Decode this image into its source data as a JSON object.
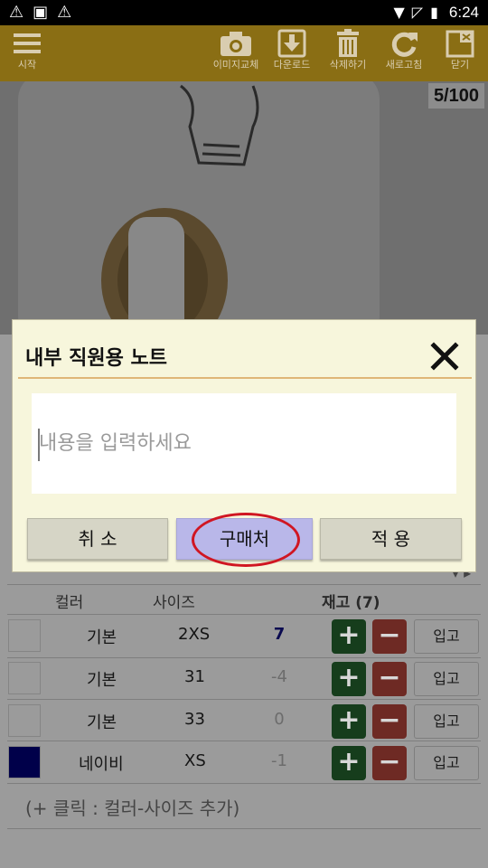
{
  "status_bar": {
    "time": "6:24"
  },
  "toolbar": {
    "menu_label": "시작",
    "buttons": [
      {
        "label": "이미지교체",
        "icon": "camera-icon"
      },
      {
        "label": "다운로드",
        "icon": "download-icon"
      },
      {
        "label": "삭제하기",
        "icon": "trash-icon"
      },
      {
        "label": "새로고침",
        "icon": "refresh-icon"
      },
      {
        "label": "닫기",
        "icon": "close-window-icon"
      }
    ]
  },
  "photo": {
    "counter": "5/100"
  },
  "dialog": {
    "title": "내부 직원용 노트",
    "input_placeholder": "내용을 입력하세요",
    "buttons": {
      "cancel": "취 소",
      "supplier": "구매처",
      "apply": "적 용"
    },
    "highlight_color": "#d01622"
  },
  "inventory": {
    "headers": {
      "color": "컬러",
      "size": "사이즈",
      "stock": "재고 (7)"
    },
    "stock_in_label": "입고",
    "rows": [
      {
        "color_name": "기본",
        "swatch": "#9b9b9b",
        "size": "2XS",
        "qty": "7"
      },
      {
        "color_name": "기본",
        "swatch": "#9b9b9b",
        "size": "31",
        "qty": "-4"
      },
      {
        "color_name": "기본",
        "swatch": "#9b9b9b",
        "size": "33",
        "qty": "0"
      },
      {
        "color_name": "네이비",
        "swatch": "#00004a",
        "size": "XS",
        "qty": "-1"
      }
    ],
    "add_hint": "(+ 클릭 : 컬러-사이즈 추가)"
  },
  "colors": {
    "toolbar_bg": "#8a6e14",
    "dialog_bg": "#f7f6dc",
    "plus_button": "#163d1c",
    "minus_button": "#6e2a24"
  }
}
